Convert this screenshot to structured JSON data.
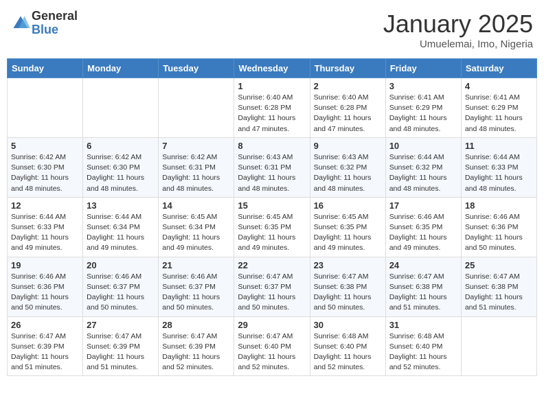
{
  "header": {
    "logo_general": "General",
    "logo_blue": "Blue",
    "month_title": "January 2025",
    "location": "Umuelemai, Imo, Nigeria"
  },
  "weekdays": [
    "Sunday",
    "Monday",
    "Tuesday",
    "Wednesday",
    "Thursday",
    "Friday",
    "Saturday"
  ],
  "weeks": [
    [
      {
        "day": "",
        "info": ""
      },
      {
        "day": "",
        "info": ""
      },
      {
        "day": "",
        "info": ""
      },
      {
        "day": "1",
        "info": "Sunrise: 6:40 AM\nSunset: 6:28 PM\nDaylight: 11 hours and 47 minutes."
      },
      {
        "day": "2",
        "info": "Sunrise: 6:40 AM\nSunset: 6:28 PM\nDaylight: 11 hours and 47 minutes."
      },
      {
        "day": "3",
        "info": "Sunrise: 6:41 AM\nSunset: 6:29 PM\nDaylight: 11 hours and 48 minutes."
      },
      {
        "day": "4",
        "info": "Sunrise: 6:41 AM\nSunset: 6:29 PM\nDaylight: 11 hours and 48 minutes."
      }
    ],
    [
      {
        "day": "5",
        "info": "Sunrise: 6:42 AM\nSunset: 6:30 PM\nDaylight: 11 hours and 48 minutes."
      },
      {
        "day": "6",
        "info": "Sunrise: 6:42 AM\nSunset: 6:30 PM\nDaylight: 11 hours and 48 minutes."
      },
      {
        "day": "7",
        "info": "Sunrise: 6:42 AM\nSunset: 6:31 PM\nDaylight: 11 hours and 48 minutes."
      },
      {
        "day": "8",
        "info": "Sunrise: 6:43 AM\nSunset: 6:31 PM\nDaylight: 11 hours and 48 minutes."
      },
      {
        "day": "9",
        "info": "Sunrise: 6:43 AM\nSunset: 6:32 PM\nDaylight: 11 hours and 48 minutes."
      },
      {
        "day": "10",
        "info": "Sunrise: 6:44 AM\nSunset: 6:32 PM\nDaylight: 11 hours and 48 minutes."
      },
      {
        "day": "11",
        "info": "Sunrise: 6:44 AM\nSunset: 6:33 PM\nDaylight: 11 hours and 48 minutes."
      }
    ],
    [
      {
        "day": "12",
        "info": "Sunrise: 6:44 AM\nSunset: 6:33 PM\nDaylight: 11 hours and 49 minutes."
      },
      {
        "day": "13",
        "info": "Sunrise: 6:44 AM\nSunset: 6:34 PM\nDaylight: 11 hours and 49 minutes."
      },
      {
        "day": "14",
        "info": "Sunrise: 6:45 AM\nSunset: 6:34 PM\nDaylight: 11 hours and 49 minutes."
      },
      {
        "day": "15",
        "info": "Sunrise: 6:45 AM\nSunset: 6:35 PM\nDaylight: 11 hours and 49 minutes."
      },
      {
        "day": "16",
        "info": "Sunrise: 6:45 AM\nSunset: 6:35 PM\nDaylight: 11 hours and 49 minutes."
      },
      {
        "day": "17",
        "info": "Sunrise: 6:46 AM\nSunset: 6:35 PM\nDaylight: 11 hours and 49 minutes."
      },
      {
        "day": "18",
        "info": "Sunrise: 6:46 AM\nSunset: 6:36 PM\nDaylight: 11 hours and 50 minutes."
      }
    ],
    [
      {
        "day": "19",
        "info": "Sunrise: 6:46 AM\nSunset: 6:36 PM\nDaylight: 11 hours and 50 minutes."
      },
      {
        "day": "20",
        "info": "Sunrise: 6:46 AM\nSunset: 6:37 PM\nDaylight: 11 hours and 50 minutes."
      },
      {
        "day": "21",
        "info": "Sunrise: 6:46 AM\nSunset: 6:37 PM\nDaylight: 11 hours and 50 minutes."
      },
      {
        "day": "22",
        "info": "Sunrise: 6:47 AM\nSunset: 6:37 PM\nDaylight: 11 hours and 50 minutes."
      },
      {
        "day": "23",
        "info": "Sunrise: 6:47 AM\nSunset: 6:38 PM\nDaylight: 11 hours and 50 minutes."
      },
      {
        "day": "24",
        "info": "Sunrise: 6:47 AM\nSunset: 6:38 PM\nDaylight: 11 hours and 51 minutes."
      },
      {
        "day": "25",
        "info": "Sunrise: 6:47 AM\nSunset: 6:38 PM\nDaylight: 11 hours and 51 minutes."
      }
    ],
    [
      {
        "day": "26",
        "info": "Sunrise: 6:47 AM\nSunset: 6:39 PM\nDaylight: 11 hours and 51 minutes."
      },
      {
        "day": "27",
        "info": "Sunrise: 6:47 AM\nSunset: 6:39 PM\nDaylight: 11 hours and 51 minutes."
      },
      {
        "day": "28",
        "info": "Sunrise: 6:47 AM\nSunset: 6:39 PM\nDaylight: 11 hours and 52 minutes."
      },
      {
        "day": "29",
        "info": "Sunrise: 6:47 AM\nSunset: 6:40 PM\nDaylight: 11 hours and 52 minutes."
      },
      {
        "day": "30",
        "info": "Sunrise: 6:48 AM\nSunset: 6:40 PM\nDaylight: 11 hours and 52 minutes."
      },
      {
        "day": "31",
        "info": "Sunrise: 6:48 AM\nSunset: 6:40 PM\nDaylight: 11 hours and 52 minutes."
      },
      {
        "day": "",
        "info": ""
      }
    ]
  ]
}
